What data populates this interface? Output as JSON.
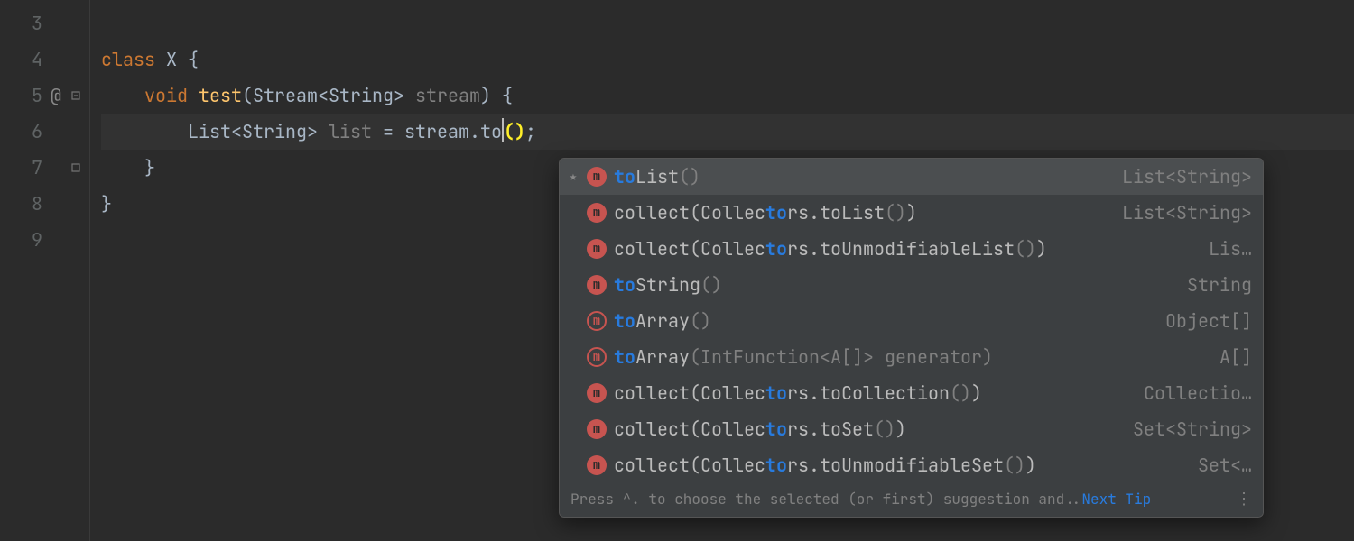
{
  "gutter": {
    "lines": [
      {
        "num": "3",
        "annot": "",
        "fold": ""
      },
      {
        "num": "4",
        "annot": "",
        "fold": ""
      },
      {
        "num": "5",
        "annot": "@",
        "fold": "open"
      },
      {
        "num": "6",
        "annot": "",
        "fold": ""
      },
      {
        "num": "7",
        "annot": "",
        "fold": "close"
      },
      {
        "num": "8",
        "annot": "",
        "fold": ""
      },
      {
        "num": "9",
        "annot": "",
        "fold": ""
      }
    ]
  },
  "code": {
    "line3": "",
    "line4_kw": "class",
    "line4_name": " X ",
    "line4_brace": "{",
    "line5_kw": "    void",
    "line5_name": " test",
    "line5_sig_pre": "(Stream<String> ",
    "line5_param": "stream",
    "line5_sig_post": ") {",
    "line6_pre": "        List<String> ",
    "line6_var": "list",
    "line6_eq": " = ",
    "line6_expr": "stream.to",
    "line6_paren_open": "(",
    "line6_paren_close": ")",
    "line6_semi": ";",
    "line7": "    }",
    "line8": "}",
    "line9": ""
  },
  "completion": {
    "items": [
      {
        "star": true,
        "badge": "m",
        "outline": false,
        "pre": "",
        "hl": "to",
        "mid": "List",
        "paren": "()",
        "post": "",
        "ret": "List<String>",
        "selected": true
      },
      {
        "star": false,
        "badge": "m",
        "outline": false,
        "pre": "collect(Collec",
        "hl": "to",
        "mid": "rs.toList",
        "paren": "()",
        "post": ")",
        "ret": "List<String>",
        "selected": false
      },
      {
        "star": false,
        "badge": "m",
        "outline": false,
        "pre": "collect(Collec",
        "hl": "to",
        "mid": "rs.toUnmodifiableList",
        "paren": "()",
        "post": ")",
        "ret": "Lis…",
        "selected": false
      },
      {
        "star": false,
        "badge": "m",
        "outline": false,
        "pre": "",
        "hl": "to",
        "mid": "String",
        "paren": "()",
        "post": "",
        "ret": "String",
        "selected": false
      },
      {
        "star": false,
        "badge": "m",
        "outline": true,
        "pre": "",
        "hl": "to",
        "mid": "Array",
        "paren": "()",
        "post": "",
        "ret": "Object[]",
        "selected": false
      },
      {
        "star": false,
        "badge": "m",
        "outline": true,
        "pre": "",
        "hl": "to",
        "mid": "Array",
        "paren": "(IntFunction<A[]> generator)",
        "post": "",
        "ret": "A[]",
        "selected": false
      },
      {
        "star": false,
        "badge": "m",
        "outline": false,
        "pre": "collect(Collec",
        "hl": "to",
        "mid": "rs.toCollection",
        "paren": "()",
        "post": ")",
        "ret": "Collectio…",
        "selected": false
      },
      {
        "star": false,
        "badge": "m",
        "outline": false,
        "pre": "collect(Collec",
        "hl": "to",
        "mid": "rs.toSet",
        "paren": "()",
        "post": ")",
        "ret": "Set<String>",
        "selected": false
      },
      {
        "star": false,
        "badge": "m",
        "outline": false,
        "pre": "collect(Collec",
        "hl": "to",
        "mid": "rs.toUnmodifiableSet",
        "paren": "()",
        "post": ")",
        "ret": "Set<…",
        "selected": false
      }
    ],
    "footer_text": "Press ^. to choose the selected (or first) suggestion and..",
    "footer_link": "Next Tip",
    "more": "⋮"
  }
}
